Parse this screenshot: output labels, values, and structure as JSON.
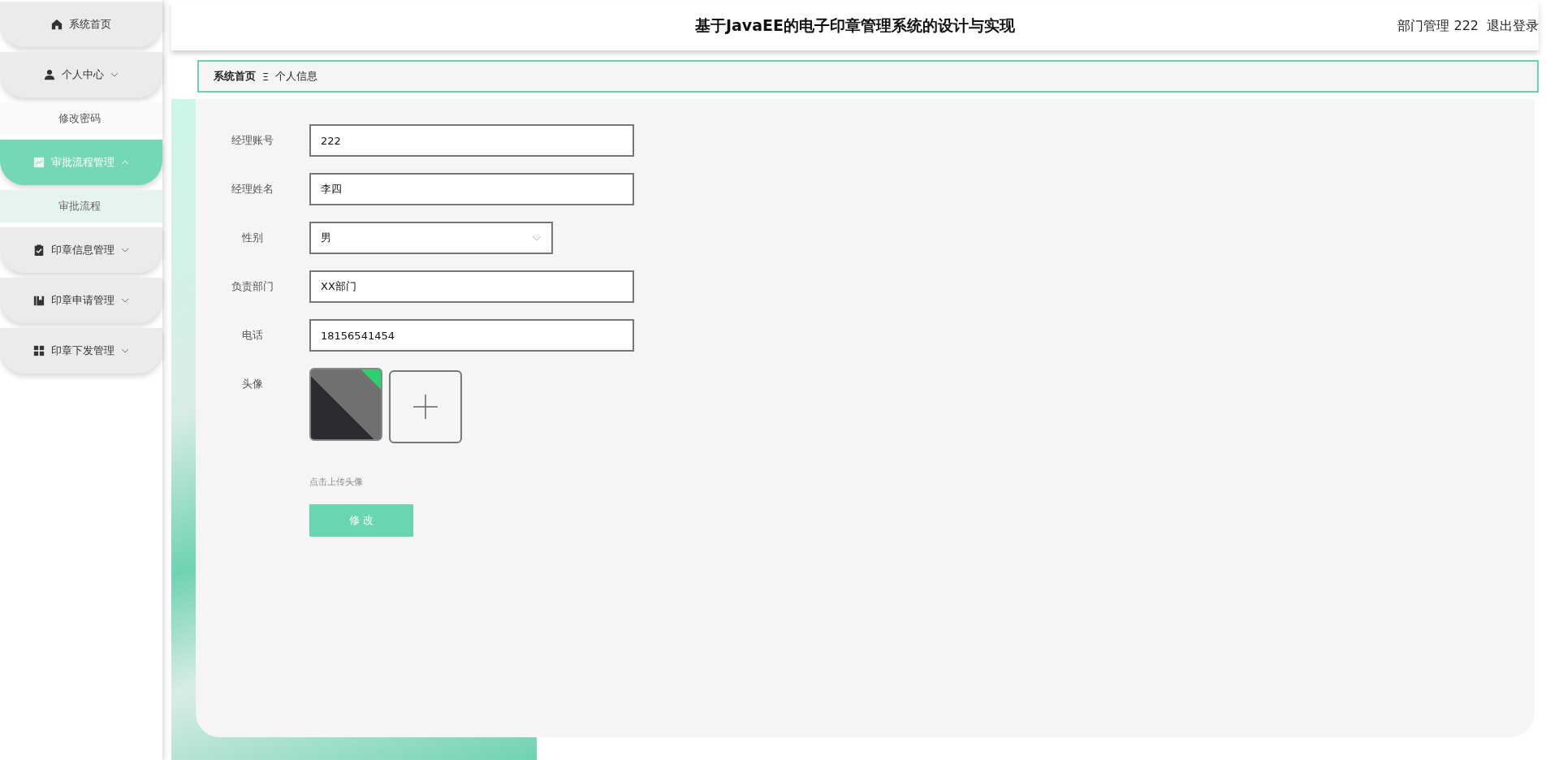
{
  "sidebar": {
    "items": [
      {
        "label": "系统首页",
        "selected": false
      },
      {
        "label": "个人中心",
        "selected": false,
        "expanded": false,
        "children": [
          {
            "label": "修改密码",
            "selected": false
          }
        ]
      },
      {
        "label": "审批流程管理",
        "selected": true,
        "expanded": true,
        "children": [
          {
            "label": "审批流程",
            "selected": true
          }
        ]
      },
      {
        "label": "印章信息管理",
        "selected": false,
        "expanded": false
      },
      {
        "label": "印章申请管理",
        "selected": false,
        "expanded": false
      },
      {
        "label": "印章下发管理",
        "selected": false,
        "expanded": false
      }
    ]
  },
  "header": {
    "title": "基于JavaEE的电子印章管理系统的设计与实现",
    "user": "部门管理 222",
    "logout": "退出登录"
  },
  "breadcrumb": {
    "home": "系统首页",
    "separator": "Ξ",
    "current": "个人信息"
  },
  "form": {
    "fields": [
      {
        "kind": "text",
        "label": "经理账号",
        "value": "222"
      },
      {
        "kind": "text",
        "label": "经理姓名",
        "value": "李四"
      },
      {
        "kind": "select",
        "label": "性别",
        "value": "男"
      },
      {
        "kind": "text",
        "label": "负责部门",
        "value": "XX部门"
      },
      {
        "kind": "text",
        "label": "电话",
        "value": "18156541454"
      },
      {
        "kind": "avatar",
        "label": "头像",
        "hint": "点击上传头像"
      }
    ],
    "submit": "修 改"
  }
}
